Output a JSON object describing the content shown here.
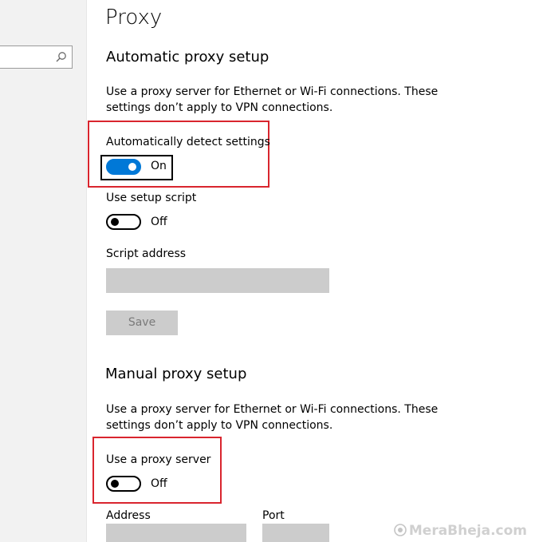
{
  "page": {
    "title": "Proxy"
  },
  "sidebar": {
    "search_placeholder": "",
    "search_icon": "search-icon"
  },
  "automatic": {
    "heading": "Automatic proxy setup",
    "description": "Use a proxy server for Ethernet or Wi-Fi connections. These settings don’t apply to VPN connections.",
    "detect_settings": {
      "label": "Automatically detect settings",
      "state": "On",
      "enabled": true
    },
    "setup_script": {
      "label": "Use setup script",
      "state": "Off",
      "enabled": false
    },
    "script_address": {
      "label": "Script address",
      "value": ""
    },
    "save_label": "Save"
  },
  "manual": {
    "heading": "Manual proxy setup",
    "description": "Use a proxy server for Ethernet or Wi-Fi connections. These settings don’t apply to VPN connections.",
    "use_proxy": {
      "label": "Use a proxy server",
      "state": "Off",
      "enabled": false
    },
    "address_label": "Address",
    "port_label": "Port",
    "address_value": "",
    "port_value": ""
  },
  "watermark": {
    "text": "MeraBheja.com"
  },
  "colors": {
    "accent": "#0078d7",
    "highlight": "#d9252e",
    "disabled": "#cccccc",
    "sidebar_bg": "#f2f2f2"
  }
}
